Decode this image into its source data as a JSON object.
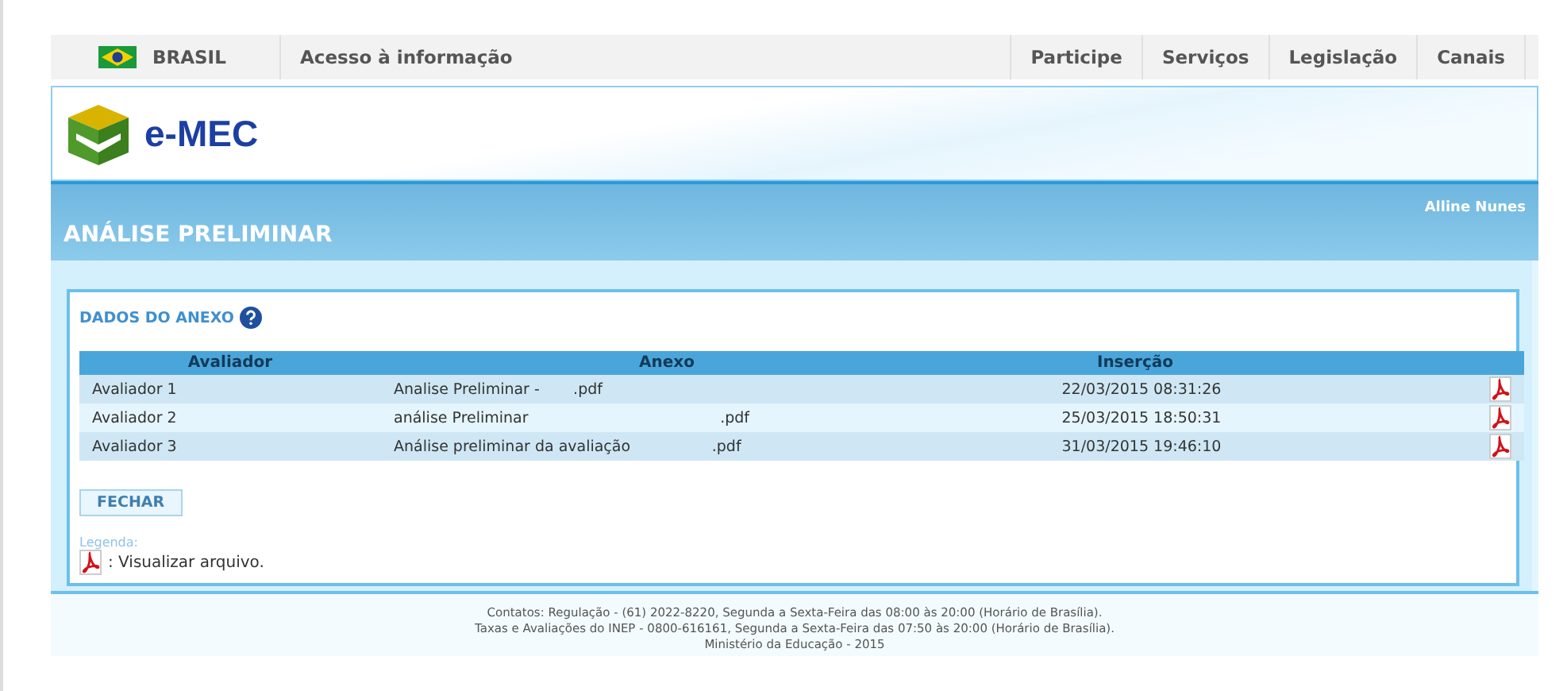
{
  "gov_bar": {
    "country": "BRASIL",
    "left_link": "Acesso à informação",
    "links": [
      "Participe",
      "Serviços",
      "Legislação",
      "Canais"
    ]
  },
  "header": {
    "logo_text": "e-MEC"
  },
  "title_band": {
    "title": "ANÁLISE PRELIMINAR",
    "user": "Alline Nunes"
  },
  "panel": {
    "title": "DADOS DO ANEXO",
    "table": {
      "columns": [
        "Avaliador",
        "Anexo",
        "Inserção"
      ],
      "rows": [
        {
          "avaliador": "Avaliador 1",
          "anexo": "Analise Preliminar -       .pdf",
          "insercao": "22/03/2015 08:31:26"
        },
        {
          "avaliador": "Avaliador 2",
          "anexo": "análise Preliminar                                        .pdf",
          "insercao": "25/03/2015 18:50:31"
        },
        {
          "avaliador": "Avaliador 3",
          "anexo": "Análise preliminar da avaliação                 .pdf",
          "insercao": "31/03/2015 19:46:10"
        }
      ]
    },
    "close_button": "FECHAR",
    "legend_label": "Legenda:",
    "legend_text": ": Visualizar arquivo."
  },
  "footer": [
    "Contatos: Regulação - (61) 2022-8220, Segunda a Sexta-Feira das 08:00 às 20:00 (Horário de Brasília).",
    "Taxas e Avaliações do INEP - 0800-616161, Segunda a Sexta-Feira das 07:50 às 20:00 (Horário de Brasília).",
    "Ministério da Educação - 2015"
  ]
}
